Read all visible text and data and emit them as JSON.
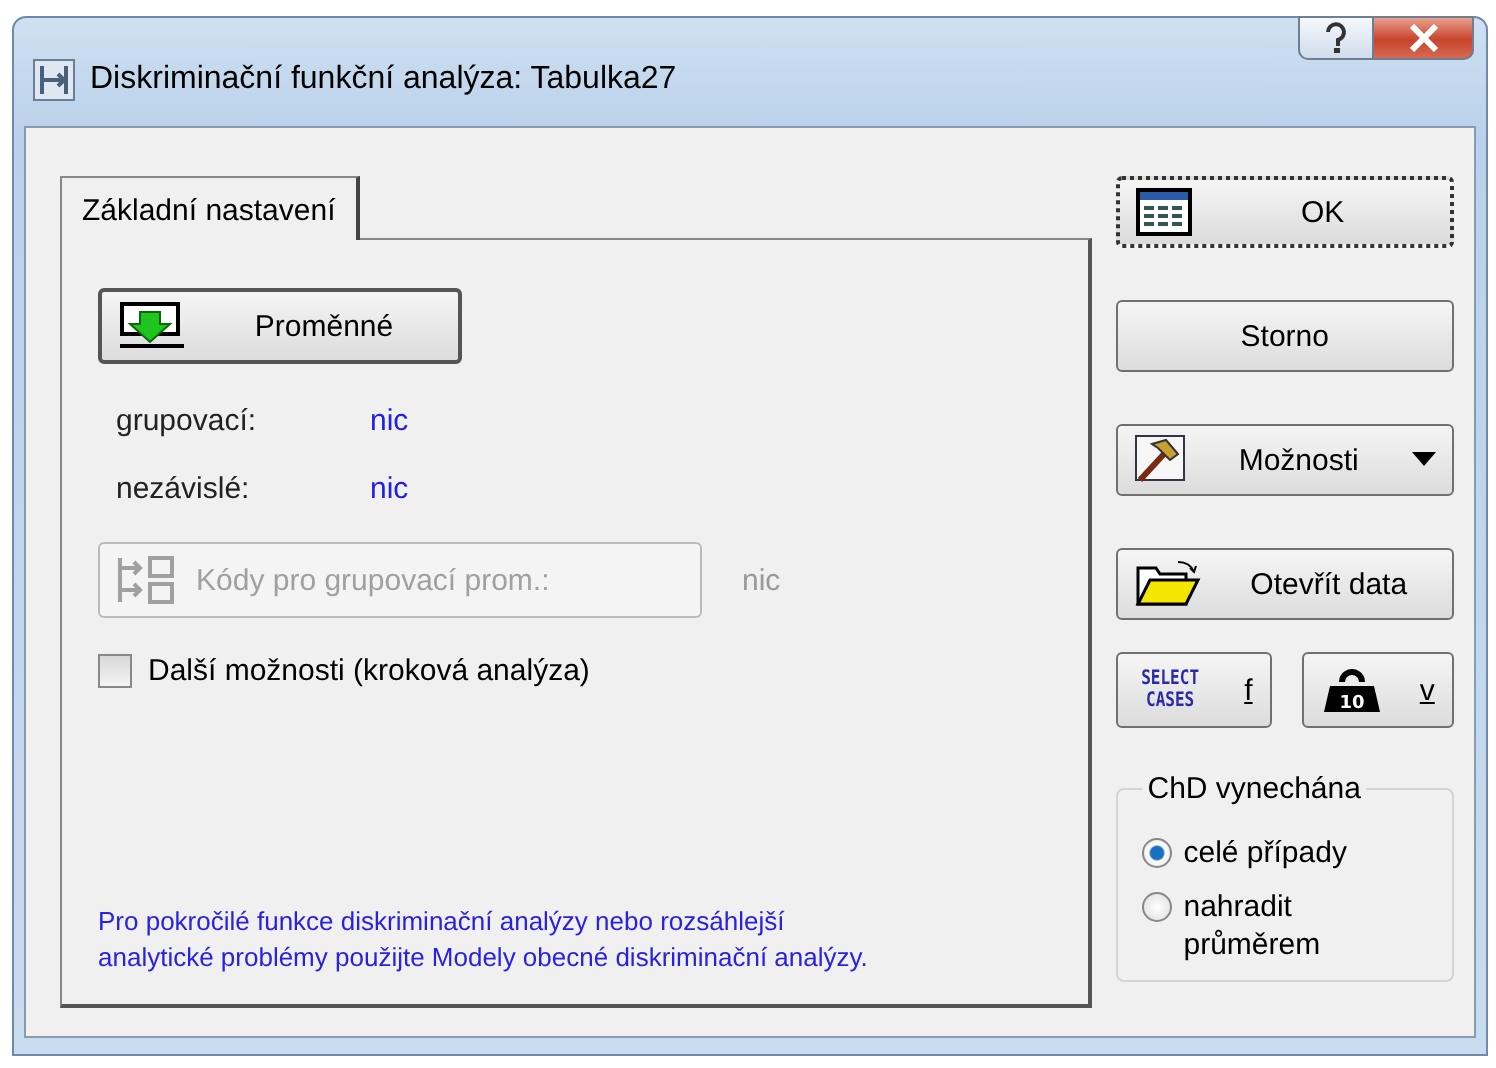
{
  "window": {
    "title": "Diskriminační funkční analýza: Tabulka27"
  },
  "tabs": [
    {
      "label": "Základní nastavení",
      "selected": true
    }
  ],
  "variables_button": {
    "label": "Proměnné"
  },
  "assignments": [
    {
      "label": "grupovací:",
      "value": "nic"
    },
    {
      "label": "nezávislé:",
      "value": "nic"
    }
  ],
  "codes_button": {
    "label": "Kódy pro grupovací prom.:",
    "disabled": true,
    "value": "nic"
  },
  "more_options": {
    "label": "Další možnosti (kroková analýza)",
    "checked": false
  },
  "note": "Pro pokročilé funkce diskriminační analýzy nebo rozsáhlejší analytické problémy použijte Modely obecné diskriminační analýzy.",
  "buttons": [
    {
      "kind": "ok",
      "label": "OK",
      "default": true
    },
    {
      "kind": "plain",
      "label": "Storno",
      "default": false
    },
    {
      "kind": "menu",
      "label": "Možnosti",
      "default": false
    },
    {
      "kind": "open",
      "label": "Otevřít data",
      "default": false
    }
  ],
  "small_buttons": [
    {
      "kind": "select_cases",
      "icon_lines": [
        "SELECT",
        "CASES"
      ],
      "label": "f"
    },
    {
      "kind": "weight",
      "icon_text": "10",
      "label": "v"
    }
  ],
  "missing_data": {
    "title": "ChD vynechána",
    "options": [
      {
        "label": "celé případy",
        "selected": true
      },
      {
        "label": "nahradit průměrem",
        "selected": false
      }
    ]
  }
}
